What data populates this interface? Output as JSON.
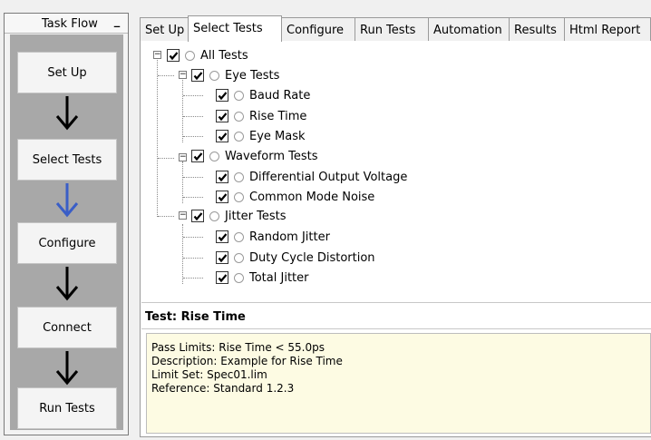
{
  "task_flow": {
    "title": "Task Flow",
    "minimize_label": "_",
    "steps": [
      {
        "label": "Set Up"
      },
      {
        "label": "Select Tests"
      },
      {
        "label": "Configure"
      },
      {
        "label": "Connect"
      },
      {
        "label": "Run Tests"
      }
    ],
    "arrows": [
      "arrow-down-icon",
      "arrow-down-icon",
      "arrow-down-icon",
      "arrow-down-icon"
    ],
    "arrow_colors": [
      "#000000",
      "#3a5ec7",
      "#000000",
      "#000000"
    ]
  },
  "tabs": [
    {
      "label": "Set Up"
    },
    {
      "label": "Select Tests",
      "active": true
    },
    {
      "label": "Configure"
    },
    {
      "label": "Run Tests"
    },
    {
      "label": "Automation"
    },
    {
      "label": "Results"
    },
    {
      "label": "Html Report"
    }
  ],
  "tree": {
    "root": {
      "label": "All Tests",
      "checked": true,
      "expanded": true
    },
    "groups": [
      {
        "label": "Eye Tests",
        "checked": true,
        "expanded": true,
        "tests": [
          {
            "label": "Baud Rate",
            "checked": true
          },
          {
            "label": "Rise Time",
            "checked": true
          },
          {
            "label": "Eye Mask",
            "checked": true
          }
        ]
      },
      {
        "label": "Waveform Tests",
        "checked": true,
        "expanded": true,
        "tests": [
          {
            "label": "Differential Output Voltage",
            "checked": true
          },
          {
            "label": "Common Mode Noise",
            "checked": true
          }
        ]
      },
      {
        "label": "Jitter Tests",
        "checked": true,
        "expanded": true,
        "tests": [
          {
            "label": "Random Jitter",
            "checked": true
          },
          {
            "label": "Duty Cycle Distortion",
            "checked": true
          },
          {
            "label": "Total Jitter",
            "checked": true
          }
        ]
      }
    ]
  },
  "details": {
    "header": "Test: Rise Time",
    "lines": [
      "Pass Limits: Rise Time < 55.0ps",
      "Description: Example for Rise Time",
      "Limit Set: Spec01.lim",
      "Reference: Standard 1.2.3"
    ]
  }
}
